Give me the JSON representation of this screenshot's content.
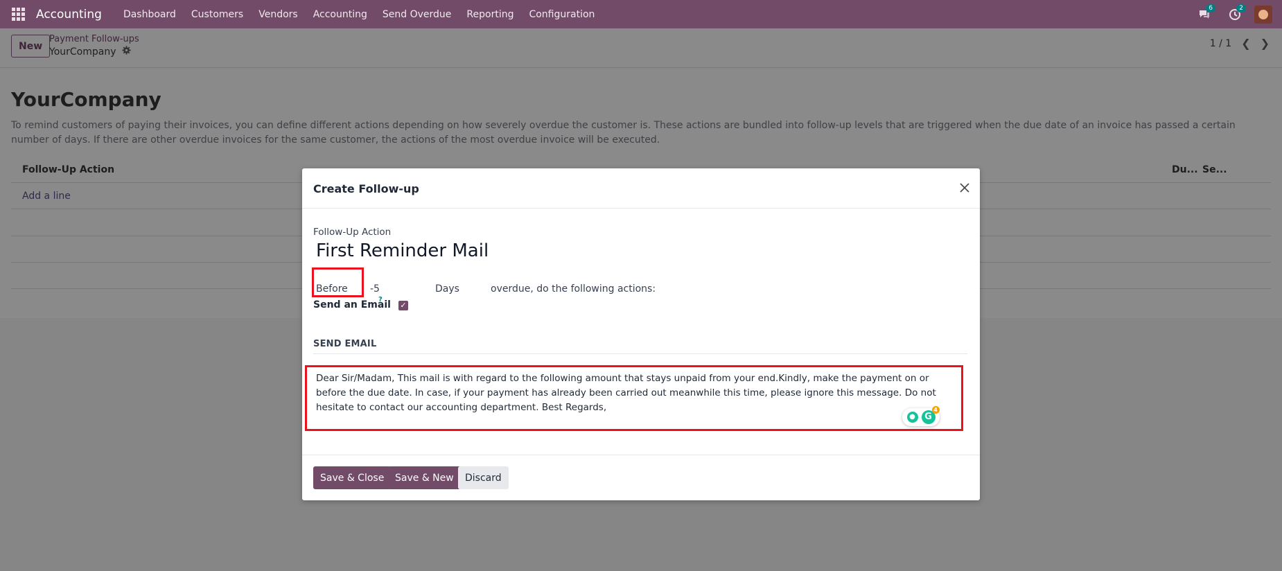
{
  "navbar": {
    "app_name": "Accounting",
    "menu": [
      "Dashboard",
      "Customers",
      "Vendors",
      "Accounting",
      "Send Overdue",
      "Reporting",
      "Configuration"
    ],
    "messages_count": "6",
    "activities_count": "2"
  },
  "control_panel": {
    "new_label": "New",
    "breadcrumb_parent": "Payment Follow-ups",
    "breadcrumb_current": "YourCompany",
    "pager": "1 / 1"
  },
  "background": {
    "title": "YourCompany",
    "description": "To remind customers of paying their invoices, you can define different actions depending on how severely overdue the customer is. These actions are bundled into follow-up levels that are triggered when the due date of an invoice has passed a certain number of days. If there are other overdue invoices for the same customer, the actions of the most overdue invoice will be executed.",
    "columns": [
      "Follow-Up Action",
      "Du...",
      "Se..."
    ],
    "add_line": "Add a line"
  },
  "modal": {
    "title": "Create Follow-up",
    "name_label": "Follow-Up Action",
    "name_value": "First Reminder Mail",
    "before_value": "Before",
    "delay_value": "-5",
    "days_label": "Days",
    "overdue_text": "overdue, do the following actions:",
    "send_email_label": "Send an Email",
    "send_email_help": "?",
    "send_email_checked": true,
    "section_title": "SEND EMAIL",
    "email_body": "Dear Sir/Madam, This mail is with regard to the following amount that stays unpaid from your end.Kindly, make the payment on or before the due date. In case, if your payment has already been carried out meanwhile this time, please ignore this message. Do not hesitate to contact our accounting department. Best Regards,",
    "grammarly_count": "4",
    "save_close": "Save & Close",
    "save_new": "Save & New",
    "discard": "Discard"
  },
  "colors": {
    "brand": "#714b67",
    "highlight": "#e8131c",
    "badge": "#017e84"
  }
}
